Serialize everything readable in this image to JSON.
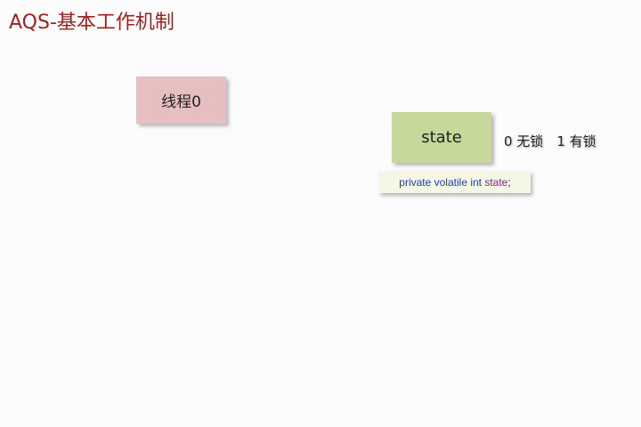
{
  "title": "AQS-基本工作机制",
  "thread": {
    "label": "线程0"
  },
  "state_box": {
    "label": "state"
  },
  "state_legend": {
    "unlocked": "0 无锁",
    "locked": "1 有锁"
  },
  "code": {
    "keywords": "private volatile int",
    "variable": "state",
    "terminator": ";"
  },
  "colors": {
    "title": "#a0201e",
    "thread_box": "#e8bfc1",
    "state_box": "#c6d99b",
    "code_box": "#f4f7e6",
    "code_keyword": "#1e3fa8",
    "code_variable": "#8a1f8a"
  }
}
